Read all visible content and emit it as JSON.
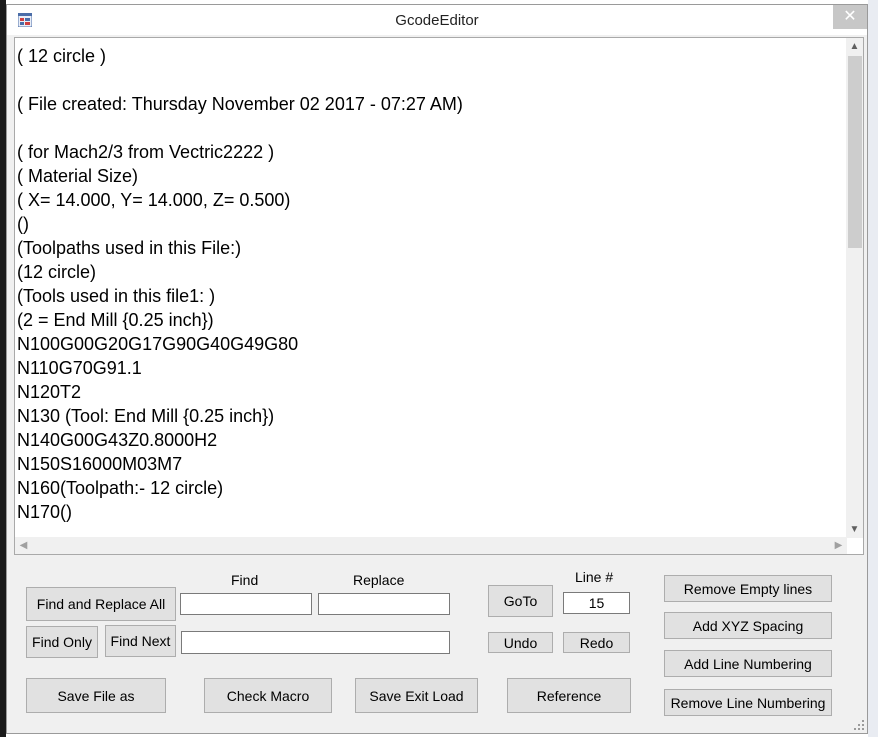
{
  "window": {
    "title": "GcodeEditor",
    "close_label": "✕"
  },
  "editor": {
    "lines": [
      "( 12 circle )",
      "",
      "( File created: Thursday November 02 2017 - 07:27 AM)",
      "",
      "( for Mach2/3 from Vectric2222 )",
      "( Material Size)",
      "( X= 14.000, Y= 14.000, Z= 0.500)",
      "()",
      "(Toolpaths used in this File:)",
      "(12 circle)",
      "(Tools used in this file1: )",
      "(2 = End Mill {0.25 inch})",
      "N100G00G20G17G90G40G49G80",
      "N110G70G91.1",
      "N120T2",
      "N130 (Tool: End Mill {0.25 inch})",
      "N140G00G43Z0.8000H2",
      "N150S16000M03M7",
      "N160(Toolpath:- 12 circle)",
      "N170()"
    ]
  },
  "controls": {
    "find_label": "Find",
    "replace_label": "Replace",
    "line_label": "Line #",
    "find_value": "",
    "replace_value": "",
    "find_next_value": "",
    "line_value": "15",
    "find_replace_all": "Find and Replace All",
    "find_only": "Find Only",
    "find_next": "Find Next",
    "goto": "GoTo",
    "undo": "Undo",
    "redo": "Redo",
    "save_file_as": "Save File as",
    "check_macro": "Check Macro",
    "save_exit_load": "Save Exit Load",
    "reference": "Reference",
    "remove_empty_lines": "Remove Empty lines",
    "add_xyz_spacing": "Add XYZ Spacing",
    "add_line_numbering": "Add Line Numbering",
    "remove_line_numbering": "Remove Line Numbering"
  }
}
